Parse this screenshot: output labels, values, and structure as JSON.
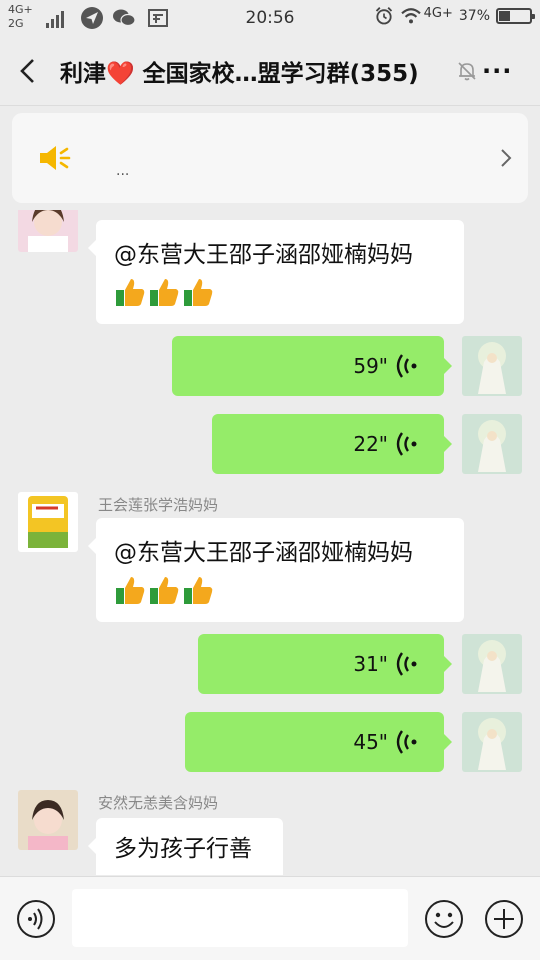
{
  "statusbar": {
    "network_top": "4G+",
    "network_bottom": "2G",
    "time": "20:56",
    "network_right": "4G+",
    "battery": "37%",
    "battery_level": 0.37
  },
  "titlebar": {
    "title": "利津❤️ 全国家校…盟学习群(355)"
  },
  "notice": {
    "text": "..."
  },
  "messages": [
    {
      "dir": "in",
      "sender": "",
      "text": "@东营大王邵子涵邵娅楠妈妈",
      "emoji": "👍👍👍"
    },
    {
      "dir": "out",
      "duration": "59\""
    },
    {
      "dir": "out",
      "duration": "22\""
    },
    {
      "dir": "in",
      "sender": "王会莲张学浩妈妈",
      "text": "@东营大王邵子涵邵娅楠妈妈",
      "emoji": "👍👍👍"
    },
    {
      "dir": "out",
      "duration": "31\""
    },
    {
      "dir": "out",
      "duration": "45\""
    },
    {
      "dir": "in",
      "sender": "安然无恙美含妈妈",
      "text": "多为孩子行善"
    }
  ],
  "colors": {
    "outgoing_bubble": "#95ec69",
    "incoming_bubble": "#ffffff",
    "background": "#ececec",
    "notice_icon": "#f5b700"
  }
}
